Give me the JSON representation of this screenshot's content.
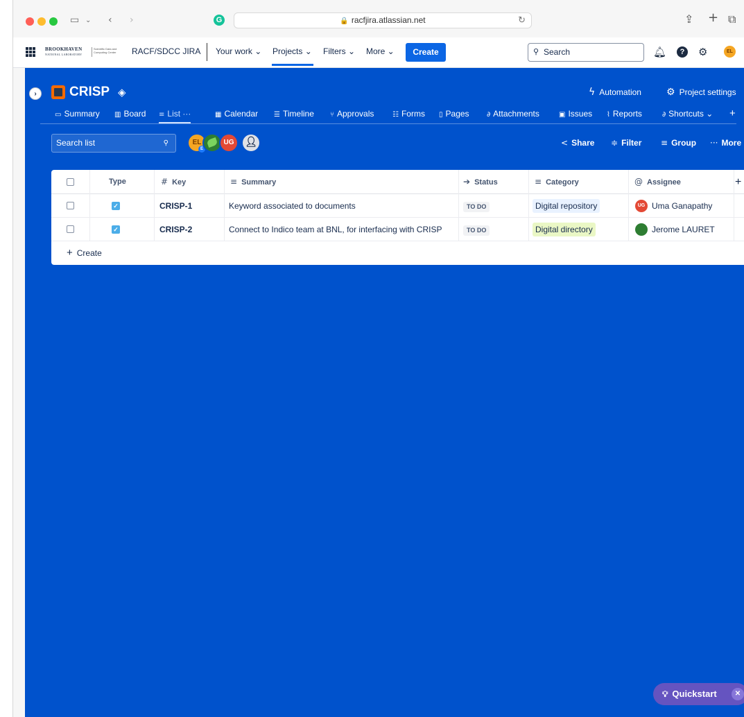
{
  "browser": {
    "url": "racfjira.atlassian.net"
  },
  "topnav": {
    "logo_text": "BROOKHAVEN",
    "logo_sub": "NATIONAL LABORATORY",
    "logo_center": "Scientific Data and Computing Center",
    "site_name": "RACF/SDCC JIRA",
    "items": [
      "Your work",
      "Projects",
      "Filters",
      "More"
    ],
    "create_label": "Create",
    "search_placeholder": "Search",
    "user_initials": "EL"
  },
  "project": {
    "name": "CRISP",
    "automation_label": "Automation",
    "settings_label": "Project settings"
  },
  "tabs": [
    {
      "label": "Summary",
      "icon": "summary-icon"
    },
    {
      "label": "Board",
      "icon": "board-icon"
    },
    {
      "label": "List ···",
      "icon": "list-icon",
      "active": true
    },
    {
      "label": "Calendar",
      "icon": "calendar-icon"
    },
    {
      "label": "Timeline",
      "icon": "timeline-icon"
    },
    {
      "label": "Approvals",
      "icon": "approvals-icon"
    },
    {
      "label": "Forms",
      "icon": "forms-icon"
    },
    {
      "label": "Pages",
      "icon": "pages-icon"
    },
    {
      "label": "Attachments",
      "icon": "attachment-icon"
    },
    {
      "label": "Issues",
      "icon": "issues-icon"
    },
    {
      "label": "Reports",
      "icon": "reports-icon"
    },
    {
      "label": "Shortcuts",
      "icon": "shortcut-icon"
    }
  ],
  "toolbar": {
    "search_placeholder": "Search list",
    "avatars": [
      {
        "initials": "EL",
        "sub": "E",
        "color": "#f5a623"
      },
      {
        "initials": "",
        "color": "#2e7d32"
      },
      {
        "initials": "UG",
        "color": "#e34935"
      }
    ],
    "share_label": "Share",
    "filter_label": "Filter",
    "group_label": "Group",
    "more_label": "More"
  },
  "table": {
    "headers": {
      "type": "Type",
      "key": "Key",
      "summary": "Summary",
      "status": "Status",
      "category": "Category",
      "assignee": "Assignee"
    },
    "rows": [
      {
        "key": "CRISP-1",
        "summary": "Keyword associated to documents",
        "status": "TO DO",
        "category": "Digital repository",
        "assignee": "Uma Ganapathy",
        "assignee_initials": "UG"
      },
      {
        "key": "CRISP-2",
        "summary": "Connect to Indico team at BNL, for interfacing with CRISP",
        "status": "TO DO",
        "category": "Digital directory",
        "assignee": "Jerome LAURET",
        "assignee_initials": ""
      }
    ],
    "create_label": "Create"
  },
  "quickstart": {
    "label": "Quickstart"
  },
  "colors": {
    "page_bg": "#0052cc",
    "primary": "#0c66e4",
    "quickstart": "#6554c0"
  }
}
